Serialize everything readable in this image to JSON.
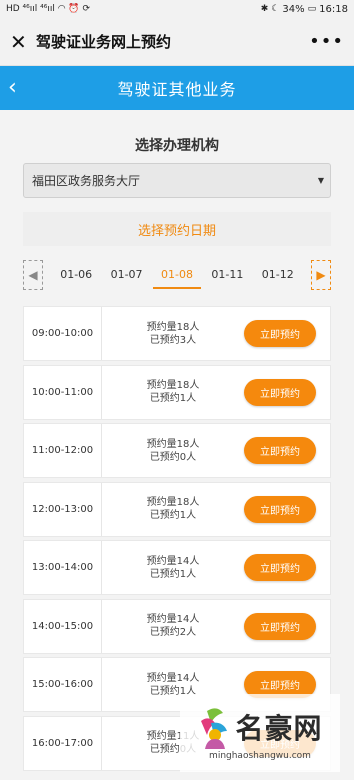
{
  "statusbar": {
    "left_icons": "HD ⁴⁶ııl ⁴⁶ııl ◠ ⏰ ⟳",
    "battery": "34%",
    "time": "16:18"
  },
  "wechat": {
    "title": "驾驶证业务网上预约",
    "close": "✕",
    "more": "•••"
  },
  "navbar": {
    "back": "‹",
    "title": "驾驶证其他业务"
  },
  "institution": {
    "label": "选择办理机构",
    "selected": "福田区政务服务大厅"
  },
  "date_picker": {
    "label": "选择预约日期",
    "dates": [
      "01-06",
      "01-07",
      "01-08",
      "01-11",
      "01-12"
    ],
    "selected": "01-08"
  },
  "slots": [
    {
      "time": "09:00-10:00",
      "quota": "预约量18人",
      "booked": "已预约3人",
      "button": "立即预约"
    },
    {
      "time": "10:00-11:00",
      "quota": "预约量18人",
      "booked": "已预约1人",
      "button": "立即预约"
    },
    {
      "time": "11:00-12:00",
      "quota": "预约量18人",
      "booked": "已预约0人",
      "button": "立即预约"
    },
    {
      "time": "12:00-13:00",
      "quota": "预约量18人",
      "booked": "已预约1人",
      "button": "立即预约"
    },
    {
      "time": "13:00-14:00",
      "quota": "预约量14人",
      "booked": "已预约1人",
      "button": "立即预约"
    },
    {
      "time": "14:00-15:00",
      "quota": "预约量14人",
      "booked": "已预约2人",
      "button": "立即预约"
    },
    {
      "time": "15:00-16:00",
      "quota": "预约量14人",
      "booked": "已预约1人",
      "button": "立即预约"
    },
    {
      "time": "16:00-17:00",
      "quota": "预约量11人",
      "booked": "已预约0人",
      "button": "立即预约"
    }
  ],
  "watermark": {
    "name": "名豪网",
    "url": "minghaoshangwu.com"
  },
  "colors": {
    "nav_blue": "#1e9ee6",
    "accent_orange": "#f5890d"
  }
}
